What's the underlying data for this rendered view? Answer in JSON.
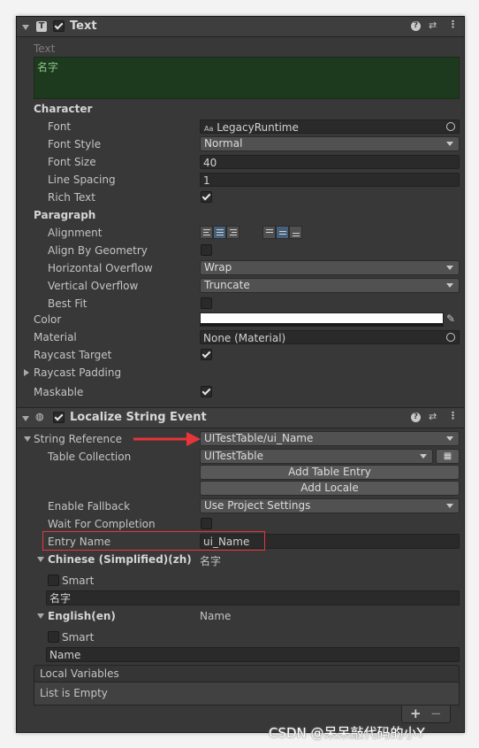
{
  "text_component": {
    "title": "Text",
    "text_label": "Text",
    "text_value": "名字",
    "character_heading": "Character",
    "font_label": "Font",
    "font_value": "LegacyRuntime",
    "font_icon_text": "Aa",
    "font_style_label": "Font Style",
    "font_style_value": "Normal",
    "font_size_label": "Font Size",
    "font_size_value": "40",
    "line_spacing_label": "Line Spacing",
    "line_spacing_value": "1",
    "rich_text_label": "Rich Text",
    "paragraph_heading": "Paragraph",
    "alignment_label": "Alignment",
    "align_by_geometry_label": "Align By Geometry",
    "horizontal_overflow_label": "Horizontal Overflow",
    "horizontal_overflow_value": "Wrap",
    "vertical_overflow_label": "Vertical Overflow",
    "vertical_overflow_value": "Truncate",
    "best_fit_label": "Best Fit",
    "color_label": "Color",
    "material_label": "Material",
    "material_value": "None (Material)",
    "raycast_target_label": "Raycast Target",
    "raycast_padding_label": "Raycast Padding",
    "maskable_label": "Maskable"
  },
  "localize_component": {
    "title": "Localize String Event",
    "string_reference_label": "String Reference",
    "string_reference_value": "UITestTable/ui_Name",
    "table_collection_label": "Table Collection",
    "table_collection_value": "UITestTable",
    "add_table_entry_label": "Add Table Entry",
    "add_locale_label": "Add Locale",
    "enable_fallback_label": "Enable Fallback",
    "enable_fallback_value": "Use Project Settings",
    "wait_for_completion_label": "Wait For Completion",
    "entry_name_label": "Entry Name",
    "entry_name_value": "ui_Name",
    "locales": [
      {
        "name": "Chinese (Simplified)(zh)",
        "preview": "名字",
        "smart_label": "Smart",
        "value": "名字"
      },
      {
        "name": "English(en)",
        "preview": "Name",
        "smart_label": "Smart",
        "value": "Name"
      }
    ],
    "local_variables_label": "Local Variables",
    "list_empty_label": "List is Empty",
    "add_symbol": "+",
    "remove_symbol": "−"
  },
  "watermark": "CSDN @呆呆敲代码的小Y",
  "colors": {
    "annotation_red": "#e8343a",
    "text_area_bg": "#1e3a1e",
    "selected_blue": "#46607c"
  }
}
